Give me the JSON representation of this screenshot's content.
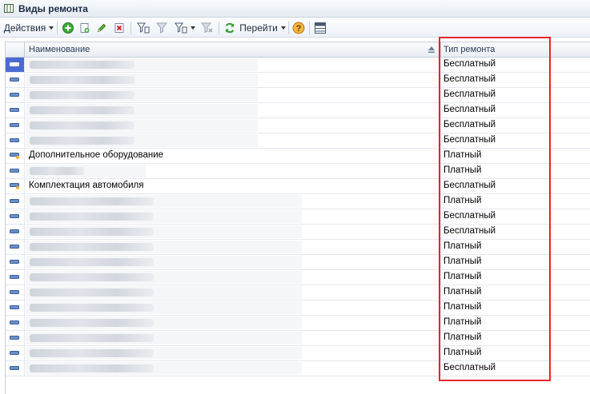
{
  "window": {
    "title": "Виды ремонта"
  },
  "toolbar": {
    "actions_label": "Действия",
    "goto_label": "Перейти"
  },
  "table": {
    "columns": [
      "Наименование",
      "Тип ремонта"
    ],
    "rows": [
      {
        "name": "",
        "type": "Бесплатный",
        "icon": "item-icon",
        "selected": true
      },
      {
        "name": "",
        "type": "Бесплатный",
        "icon": "item-icon"
      },
      {
        "name": "",
        "type": "Бесплатный",
        "icon": "item-icon"
      },
      {
        "name": "",
        "type": "Бесплатный",
        "icon": "item-icon"
      },
      {
        "name": "",
        "type": "Бесплатный",
        "icon": "item-icon"
      },
      {
        "name": "",
        "type": "Бесплатный",
        "icon": "item-icon"
      },
      {
        "name": "Дополнительное оборудование",
        "type": "Платный",
        "icon": "item-edit-icon"
      },
      {
        "name": "",
        "type": "Платный",
        "icon": "item-icon"
      },
      {
        "name": "Комплектация автомобиля",
        "type": "Бесплатный",
        "icon": "item-edit-icon"
      },
      {
        "name": "",
        "type": "Платный",
        "icon": "item-icon"
      },
      {
        "name": "",
        "type": "Бесплатный",
        "icon": "item-icon"
      },
      {
        "name": "",
        "type": "Бесплатный",
        "icon": "item-icon"
      },
      {
        "name": "",
        "type": "Платный",
        "icon": "item-icon"
      },
      {
        "name": "",
        "type": "Платный",
        "icon": "item-icon"
      },
      {
        "name": "",
        "type": "Платный",
        "icon": "item-icon"
      },
      {
        "name": "",
        "type": "Платный",
        "icon": "item-icon"
      },
      {
        "name": "",
        "type": "Платный",
        "icon": "item-icon"
      },
      {
        "name": "",
        "type": "Платный",
        "icon": "item-icon"
      },
      {
        "name": "",
        "type": "Платный",
        "icon": "item-icon"
      },
      {
        "name": "",
        "type": "Платный",
        "icon": "item-icon"
      },
      {
        "name": "",
        "type": "Бесплатный",
        "icon": "item-icon"
      }
    ]
  },
  "colors": {
    "accent": "#4a6bd1",
    "highlight_border": "#e3262b"
  }
}
